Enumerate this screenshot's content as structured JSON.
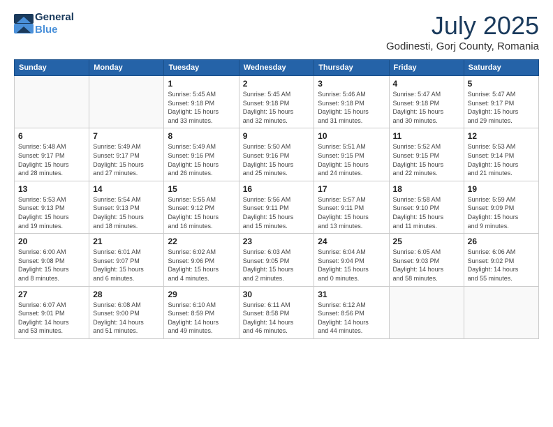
{
  "header": {
    "logo_line1": "General",
    "logo_line2": "Blue",
    "month_title": "July 2025",
    "location": "Godinesti, Gorj County, Romania"
  },
  "weekdays": [
    "Sunday",
    "Monday",
    "Tuesday",
    "Wednesday",
    "Thursday",
    "Friday",
    "Saturday"
  ],
  "weeks": [
    [
      {
        "day": "",
        "info": ""
      },
      {
        "day": "",
        "info": ""
      },
      {
        "day": "1",
        "info": "Sunrise: 5:45 AM\nSunset: 9:18 PM\nDaylight: 15 hours\nand 33 minutes."
      },
      {
        "day": "2",
        "info": "Sunrise: 5:45 AM\nSunset: 9:18 PM\nDaylight: 15 hours\nand 32 minutes."
      },
      {
        "day": "3",
        "info": "Sunrise: 5:46 AM\nSunset: 9:18 PM\nDaylight: 15 hours\nand 31 minutes."
      },
      {
        "day": "4",
        "info": "Sunrise: 5:47 AM\nSunset: 9:18 PM\nDaylight: 15 hours\nand 30 minutes."
      },
      {
        "day": "5",
        "info": "Sunrise: 5:47 AM\nSunset: 9:17 PM\nDaylight: 15 hours\nand 29 minutes."
      }
    ],
    [
      {
        "day": "6",
        "info": "Sunrise: 5:48 AM\nSunset: 9:17 PM\nDaylight: 15 hours\nand 28 minutes."
      },
      {
        "day": "7",
        "info": "Sunrise: 5:49 AM\nSunset: 9:17 PM\nDaylight: 15 hours\nand 27 minutes."
      },
      {
        "day": "8",
        "info": "Sunrise: 5:49 AM\nSunset: 9:16 PM\nDaylight: 15 hours\nand 26 minutes."
      },
      {
        "day": "9",
        "info": "Sunrise: 5:50 AM\nSunset: 9:16 PM\nDaylight: 15 hours\nand 25 minutes."
      },
      {
        "day": "10",
        "info": "Sunrise: 5:51 AM\nSunset: 9:15 PM\nDaylight: 15 hours\nand 24 minutes."
      },
      {
        "day": "11",
        "info": "Sunrise: 5:52 AM\nSunset: 9:15 PM\nDaylight: 15 hours\nand 22 minutes."
      },
      {
        "day": "12",
        "info": "Sunrise: 5:53 AM\nSunset: 9:14 PM\nDaylight: 15 hours\nand 21 minutes."
      }
    ],
    [
      {
        "day": "13",
        "info": "Sunrise: 5:53 AM\nSunset: 9:13 PM\nDaylight: 15 hours\nand 19 minutes."
      },
      {
        "day": "14",
        "info": "Sunrise: 5:54 AM\nSunset: 9:13 PM\nDaylight: 15 hours\nand 18 minutes."
      },
      {
        "day": "15",
        "info": "Sunrise: 5:55 AM\nSunset: 9:12 PM\nDaylight: 15 hours\nand 16 minutes."
      },
      {
        "day": "16",
        "info": "Sunrise: 5:56 AM\nSunset: 9:11 PM\nDaylight: 15 hours\nand 15 minutes."
      },
      {
        "day": "17",
        "info": "Sunrise: 5:57 AM\nSunset: 9:11 PM\nDaylight: 15 hours\nand 13 minutes."
      },
      {
        "day": "18",
        "info": "Sunrise: 5:58 AM\nSunset: 9:10 PM\nDaylight: 15 hours\nand 11 minutes."
      },
      {
        "day": "19",
        "info": "Sunrise: 5:59 AM\nSunset: 9:09 PM\nDaylight: 15 hours\nand 9 minutes."
      }
    ],
    [
      {
        "day": "20",
        "info": "Sunrise: 6:00 AM\nSunset: 9:08 PM\nDaylight: 15 hours\nand 8 minutes."
      },
      {
        "day": "21",
        "info": "Sunrise: 6:01 AM\nSunset: 9:07 PM\nDaylight: 15 hours\nand 6 minutes."
      },
      {
        "day": "22",
        "info": "Sunrise: 6:02 AM\nSunset: 9:06 PM\nDaylight: 15 hours\nand 4 minutes."
      },
      {
        "day": "23",
        "info": "Sunrise: 6:03 AM\nSunset: 9:05 PM\nDaylight: 15 hours\nand 2 minutes."
      },
      {
        "day": "24",
        "info": "Sunrise: 6:04 AM\nSunset: 9:04 PM\nDaylight: 15 hours\nand 0 minutes."
      },
      {
        "day": "25",
        "info": "Sunrise: 6:05 AM\nSunset: 9:03 PM\nDaylight: 14 hours\nand 58 minutes."
      },
      {
        "day": "26",
        "info": "Sunrise: 6:06 AM\nSunset: 9:02 PM\nDaylight: 14 hours\nand 55 minutes."
      }
    ],
    [
      {
        "day": "27",
        "info": "Sunrise: 6:07 AM\nSunset: 9:01 PM\nDaylight: 14 hours\nand 53 minutes."
      },
      {
        "day": "28",
        "info": "Sunrise: 6:08 AM\nSunset: 9:00 PM\nDaylight: 14 hours\nand 51 minutes."
      },
      {
        "day": "29",
        "info": "Sunrise: 6:10 AM\nSunset: 8:59 PM\nDaylight: 14 hours\nand 49 minutes."
      },
      {
        "day": "30",
        "info": "Sunrise: 6:11 AM\nSunset: 8:58 PM\nDaylight: 14 hours\nand 46 minutes."
      },
      {
        "day": "31",
        "info": "Sunrise: 6:12 AM\nSunset: 8:56 PM\nDaylight: 14 hours\nand 44 minutes."
      },
      {
        "day": "",
        "info": ""
      },
      {
        "day": "",
        "info": ""
      }
    ]
  ]
}
